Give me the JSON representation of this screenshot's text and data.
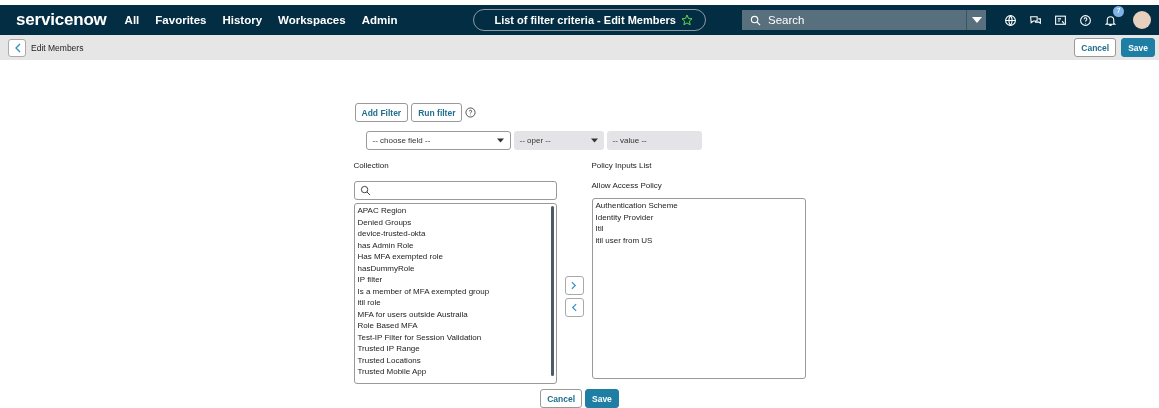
{
  "nav": {
    "logo": "servicenow",
    "items": [
      "All",
      "Favorites",
      "History",
      "Workspaces",
      "Admin"
    ],
    "title": "List of filter criteria - Edit Members",
    "search": {
      "placeholder": "Search"
    },
    "notification_count": "7"
  },
  "header": {
    "title": "Edit Members",
    "buttons": [
      "Cancel",
      "Save"
    ]
  },
  "filter": {
    "buttons": [
      "Add Filter",
      "Run filter"
    ],
    "field": "-- choose field --",
    "operator": "-- oper --",
    "value": "-- value --"
  },
  "collection": {
    "label": "Collection",
    "items": [
      "APAC Region",
      "Denied Groups",
      "device-trusted-okta",
      "has Admin Role",
      "Has MFA exempted role",
      "hasDummyRole",
      "IP filter",
      "Is a member of MFA exempted group",
      "itil role",
      "MFA for users outside Austraila",
      "Role Based MFA",
      "Test-IP Filter for Session Validation",
      "Trusted IP Range",
      "Trusted Locations",
      "Trusted Mobile App"
    ]
  },
  "selected": {
    "label": "Policy Inputs List",
    "sublabel": "Allow Access Policy",
    "items": [
      "Authentication Scheme",
      "Identity Provider",
      "Itil",
      "itil user from US"
    ]
  },
  "footer": {
    "buttons": [
      "Cancel",
      "Save"
    ]
  }
}
